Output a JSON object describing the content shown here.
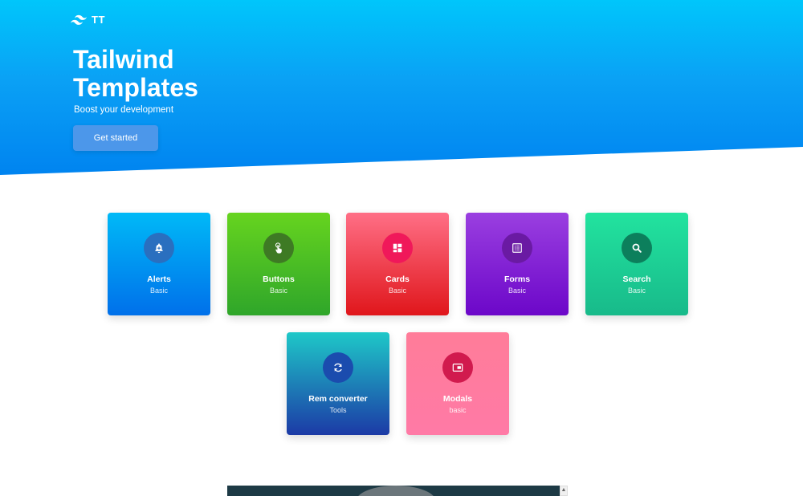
{
  "brand": {
    "logo_icon": "tailwind-logo-icon",
    "name": "TT"
  },
  "hero": {
    "title": "Tailwind Templates",
    "subtitle": "Boost your development",
    "cta_label": "Get started"
  },
  "cards": [
    {
      "title": "Alerts",
      "subtitle": "Basic",
      "icon": "bell-icon",
      "gradient": [
        "#00b9f7",
        "#0070ea"
      ],
      "circle": "#2a6fbf"
    },
    {
      "title": "Buttons",
      "subtitle": "Basic",
      "icon": "pointer-hand-icon",
      "gradient": [
        "#66d41f",
        "#2fa62a"
      ],
      "circle": "#3e7a24"
    },
    {
      "title": "Cards",
      "subtitle": "Basic",
      "icon": "grid-layout-icon",
      "gradient": [
        "#ff6f86",
        "#e0161b"
      ],
      "circle": "#f0185a"
    },
    {
      "title": "Forms",
      "subtitle": "Basic",
      "icon": "form-list-icon",
      "gradient": [
        "#9a3fe0",
        "#6c07c9"
      ],
      "circle": "#6a1aa3"
    },
    {
      "title": "Search",
      "subtitle": "Basic",
      "icon": "search-icon",
      "gradient": [
        "#22e39f",
        "#18ba8a"
      ],
      "circle": "#0c7f5c"
    },
    {
      "title": "Rem converter",
      "subtitle": "Tools",
      "icon": "refresh-icon",
      "gradient": [
        "#1ec8c8",
        "#1c3aa6"
      ],
      "circle": "#1b4cae"
    },
    {
      "title": "Modals",
      "subtitle": "basic",
      "icon": "modal-window-icon",
      "gradient": [
        "#ff7c99",
        "#ff7aa6"
      ],
      "circle": "#d11a4e"
    }
  ]
}
